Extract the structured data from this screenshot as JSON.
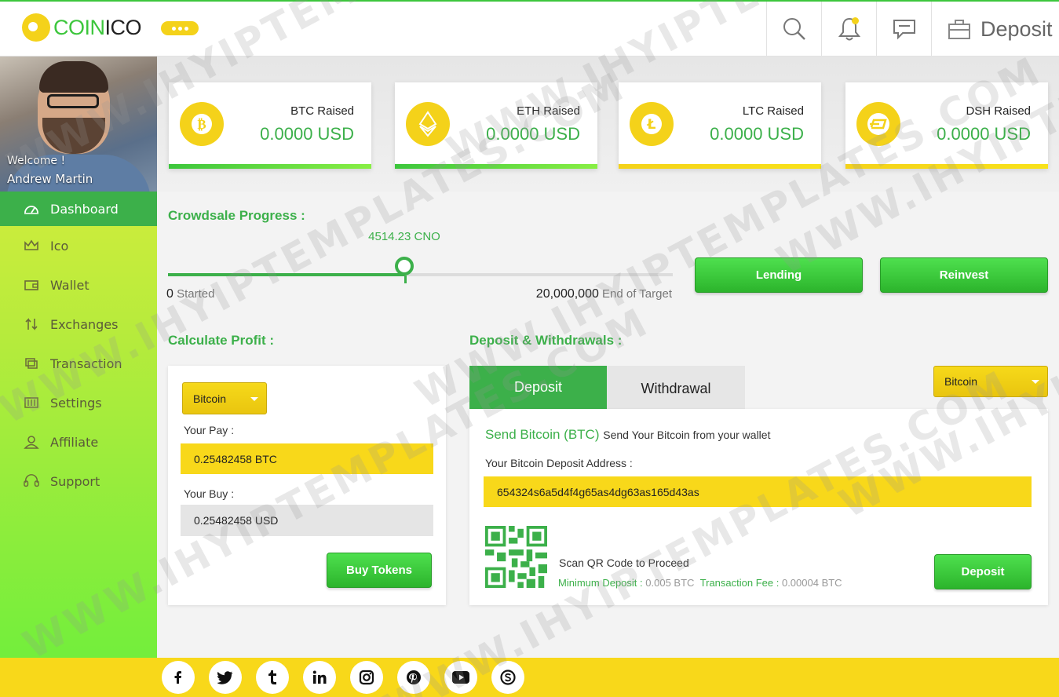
{
  "brand": {
    "coin": "COIN",
    "ico": "ICO"
  },
  "header": {
    "deposit_label": "Deposit"
  },
  "profile": {
    "welcome": "Welcome !",
    "name": "Andrew Martin"
  },
  "nav": [
    {
      "label": "Dashboard",
      "icon": "dashboard-icon",
      "active": true
    },
    {
      "label": "Ico",
      "icon": "crown-icon"
    },
    {
      "label": "Wallet",
      "icon": "wallet-icon"
    },
    {
      "label": "Exchanges",
      "icon": "exchange-icon"
    },
    {
      "label": "Transaction",
      "icon": "transaction-icon"
    },
    {
      "label": "Settings",
      "icon": "settings-icon"
    },
    {
      "label": "Affiliate",
      "icon": "user-icon"
    },
    {
      "label": "Support",
      "icon": "headset-icon"
    }
  ],
  "stats": [
    {
      "label": "BTC Raised",
      "value": "0.0000 USD",
      "icon": "bitcoin-icon",
      "accent": "green"
    },
    {
      "label": "ETH Raised",
      "value": "0.0000 USD",
      "icon": "ethereum-icon",
      "accent": "green"
    },
    {
      "label": "LTC Raised",
      "value": "0.0000 USD",
      "icon": "litecoin-icon",
      "accent": "yellow"
    },
    {
      "label": "DSH Raised",
      "value": "0.0000 USD",
      "icon": "dash-icon",
      "accent": "yellow"
    }
  ],
  "crowdsale": {
    "title": "Crowdsale Progress :",
    "current": "4514.23 CNO",
    "progress_fraction": 0.468,
    "start_value": "0",
    "start_label": "Started",
    "end_value": "20,000,000",
    "end_label": "End of Target"
  },
  "actions": {
    "lending": "Lending",
    "reinvest": "Reinvest"
  },
  "calculator": {
    "title": "Calculate Profit :",
    "currency": "Bitcoin",
    "pay_label": "Your Pay :",
    "pay_value": "0.25482458 BTC",
    "buy_label": "Your Buy :",
    "buy_value": "0.25482458 USD",
    "button": "Buy Tokens"
  },
  "deposit": {
    "title": "Deposit & Withdrawals :",
    "tab_deposit": "Deposit",
    "tab_withdrawal": "Withdrawal",
    "currency": "Bitcoin",
    "send_title": "Send Bitcoin (BTC)",
    "send_sub": "Send Your Bitcoin from your wallet",
    "address_label": "Your Bitcoin Deposit Address :",
    "address": "654324s6a5d4f4g65as4dg63as165d43as",
    "scan_label": "Scan QR Code to Proceed",
    "min_label": "Minimum Deposit :",
    "min_value": "0.005 BTC",
    "fee_label": "Transaction Fee :",
    "fee_value": "0.00004 BTC",
    "button": "Deposit"
  },
  "social": [
    "facebook-icon",
    "twitter-icon",
    "tumblr-icon",
    "linkedin-icon",
    "instagram-icon",
    "pinterest-icon",
    "youtube-icon",
    "skype-icon"
  ],
  "colors": {
    "green": "#3cb04a",
    "yellow": "#f8d81a"
  },
  "watermark": "WWW.IHYIPTEMPLATES.COM"
}
